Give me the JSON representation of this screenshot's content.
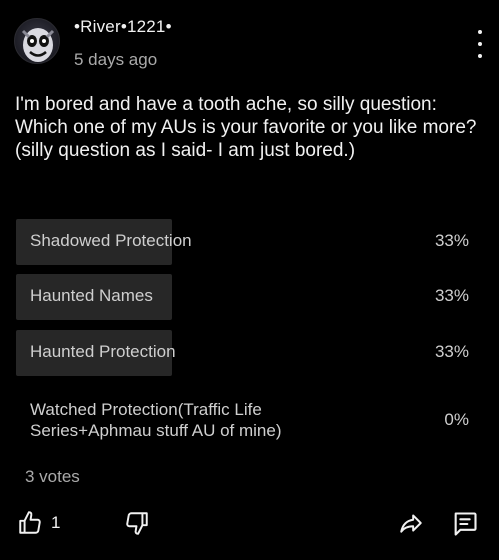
{
  "post": {
    "author": "•River•1221•",
    "time": "5 days ago",
    "text": "I'm bored and have a tooth ache, so silly question: Which one of my AUs is your favorite or you like more?\n(silly question as I said- I am just bored.)"
  },
  "poll": {
    "options": [
      {
        "label": "Shadowed Protection",
        "percent": "33%",
        "fill_fraction": 0.33
      },
      {
        "label": "Haunted Names",
        "percent": "33%",
        "fill_fraction": 0.33
      },
      {
        "label": "Haunted Protection",
        "percent": "33%",
        "fill_fraction": 0.33
      },
      {
        "label": "Watched Protection(Traffic Life Series+Aphmau stuff AU of mine)",
        "percent": "0%",
        "fill_fraction": 0
      }
    ],
    "votes": "3 votes"
  },
  "actions": {
    "like_count": "1"
  },
  "icons": {
    "menu": "more-vert-icon",
    "like": "thumbs-up-icon",
    "dislike": "thumbs-down-icon",
    "share": "share-icon",
    "comment": "comment-icon"
  }
}
